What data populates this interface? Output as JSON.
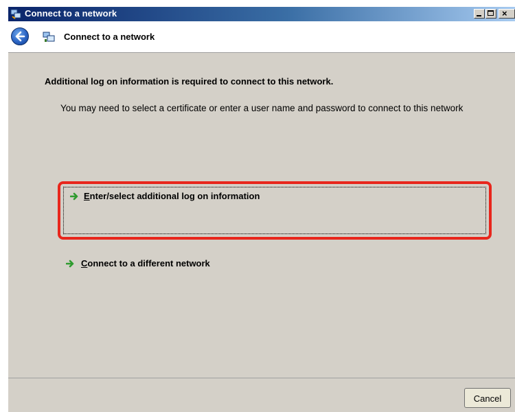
{
  "window": {
    "title": "Connect to a network",
    "controls": [
      "minimize",
      "maximize",
      "close"
    ],
    "close_glyph": "×"
  },
  "header": {
    "back_icon": "back-arrow-icon",
    "icon": "network-icon",
    "title": "Connect to a network"
  },
  "content": {
    "heading": "Additional log on information is required to connect to this network.",
    "description": "You may need to select a certificate or enter a user name and password to connect to this network",
    "options": [
      {
        "mnemonic": "E",
        "rest": "nter/select additional log on information",
        "icon": "green-arrow-icon",
        "highlighted": true,
        "highlight_color": "#e8261c"
      },
      {
        "mnemonic": "C",
        "rest": "onnect to a different network",
        "icon": "green-arrow-icon",
        "highlighted": false
      }
    ]
  },
  "footer": {
    "cancel_label": "Cancel"
  }
}
